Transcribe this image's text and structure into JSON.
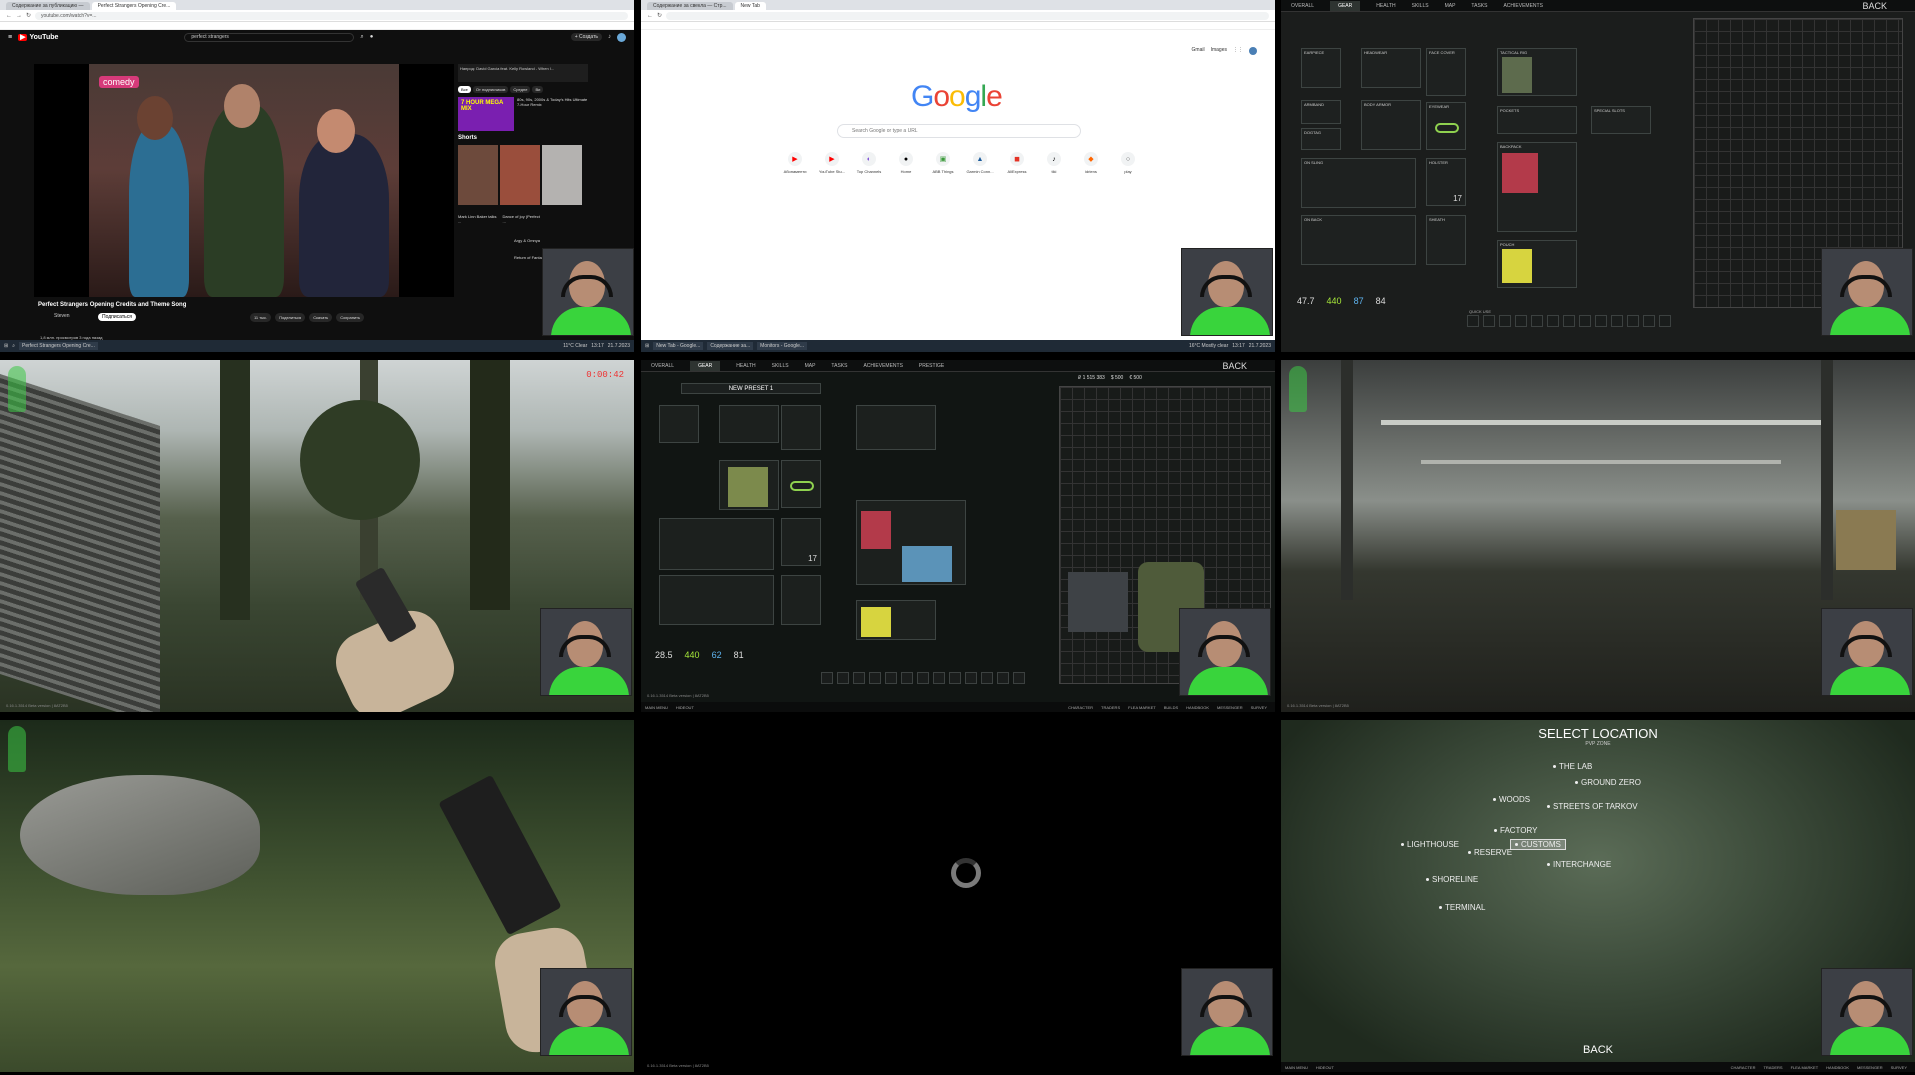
{
  "youtube": {
    "tabs": [
      "Содержание за публикацию —",
      "Perfect Strangers Opening Cre..."
    ],
    "url": "youtube.com/watch?v=...",
    "logo": "YouTube",
    "search_value": "perfect strangers",
    "create_label": "+ Создать",
    "video_title": "Perfect Strangers Opening Credits and Theme Song",
    "channel": "Steven",
    "subscribe": "Подписаться",
    "actions": [
      "11 тыс.",
      "Поделиться",
      "Скачать",
      "Сохранить"
    ],
    "views": "1,8 млн. просмотров 3 года назад",
    "side_top": "Напрод: David Garcia feat. Kelly Rowland - When I...",
    "chips": [
      "Все",
      "От подписчиков",
      "Средне",
      "Ви"
    ],
    "side_card": "80s, 90s, 2000s & Today's Hits Ultimate 7-Hour Remix",
    "side_badge": "7 HOUR MEGA MIX",
    "shorts_label": "Shorts",
    "shorts": [
      "Mark Linn Baker talks ...",
      "Dance of joy (Perfect ..."
    ],
    "side_bottom": [
      "Argy & Omnya",
      "Return of Fantasy"
    ],
    "watermark": "comedy"
  },
  "taskbar1": {
    "weather": "11°C Clear",
    "time": "13:17",
    "date": "21.7.2023"
  },
  "google": {
    "tabs": [
      "Содержание за свекла — Стр...",
      "New Tab"
    ],
    "logo_letters": [
      "G",
      "o",
      "o",
      "g",
      "l",
      "e"
    ],
    "logo_colors": [
      "#4285f4",
      "#ea4335",
      "#fbbc05",
      "#4285f4",
      "#34a853",
      "#ea4335"
    ],
    "search_placeholder": "Search Google or type a URL",
    "top_links": [
      "Gmail",
      "Images"
    ],
    "shortcuts": [
      "Абонаменти",
      "YouTube Stu...",
      "Top Channels",
      "Home",
      "ABB Things",
      "Garmin Conn...",
      "AliExpress",
      "tiki",
      "idriens",
      "play"
    ]
  },
  "taskbar2": {
    "weather": "16°C Mostly clear",
    "time": "13:17",
    "date": "21.7.2023",
    "windows": [
      "New Tab - Google...",
      "Содержание за...",
      "Monitors - Google..."
    ]
  },
  "gear1": {
    "nav": [
      "OVERALL",
      "GEAR",
      "HEALTH",
      "SKILLS",
      "MAP",
      "TASKS",
      "ACHIEVEMENTS"
    ],
    "back": "BACK",
    "slots": [
      "EARPIECE",
      "HEADWEAR",
      "FACE COVER",
      "ARMBAND",
      "BODY ARMOR",
      "EYEWEAR",
      "DOGTAG",
      "ON SLING",
      "HOLSTER",
      "ON BACK",
      "SHEATH",
      "TACTICAL RIG",
      "POCKETS",
      "SPECIAL SLOTS",
      "BACKPACK",
      "POUCH"
    ],
    "stats": [
      "47.7",
      "440",
      "87",
      "84"
    ],
    "quick": "QUICK USE",
    "ammo": "17"
  },
  "gear2": {
    "nav": [
      "OVERALL",
      "GEAR",
      "HEALTH",
      "SKILLS",
      "MAP",
      "TASKS",
      "ACHIEVEMENTS",
      "PRESTIGE"
    ],
    "back": "BACK",
    "preset": "NEW PRESET 1",
    "money": [
      "₽ 1 515 383",
      "$ 500",
      "€ 500"
    ],
    "stats": [
      "28.5",
      "440",
      "62",
      "81"
    ],
    "bottom": [
      "MAIN MENU",
      "HIDEOUT",
      "CHARACTER",
      "TRADERS",
      "FLEA MARKET",
      "BUILDS",
      "HANDBOOK",
      "MESSENGER",
      "SURVEY"
    ],
    "version": "0.16.1.3514 Beta version | 8AT2B5",
    "ammo": "17"
  },
  "raid1": {
    "timer": "0:00:42",
    "version": "0.16.1.3514 Beta version | 8AT2B5"
  },
  "raid3": {
    "version": "0.16.1.3514 Beta version | 8AT2B5"
  },
  "loading": {
    "version": "0.16.1.3514 Beta version | 8AT2B5"
  },
  "map": {
    "title": "SELECT LOCATION",
    "zone": "PVP ZONE",
    "locations": [
      "THE LAB",
      "GROUND ZERO",
      "WOODS",
      "STREETS OF TARKOV",
      "FACTORY",
      "CUSTOMS",
      "LIGHTHOUSE",
      "RESERVE",
      "INTERCHANGE",
      "SHORELINE",
      "TERMINAL"
    ],
    "back": "BACK",
    "bottom": [
      "MAIN MENU",
      "HIDEOUT",
      "CHARACTER",
      "TRADERS",
      "FLEA MARKET",
      "HANDBOOK",
      "MESSENGER",
      "SURVEY"
    ]
  }
}
